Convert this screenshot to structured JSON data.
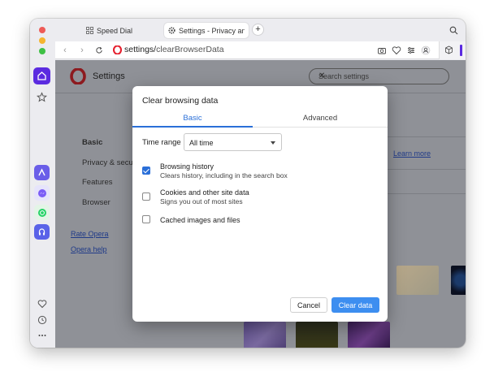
{
  "tabs": [
    {
      "label": "Speed Dial",
      "icon": "grid-icon"
    },
    {
      "label": "Settings - Privacy and se",
      "icon": "gear-icon"
    }
  ],
  "address_bar": {
    "url_prefix": "settings/",
    "url_path": "clearBrowserData"
  },
  "settings": {
    "title": "Settings",
    "search_placeholder": "Search settings",
    "menu": [
      "Basic",
      "Privacy & secu",
      "Features",
      "Browser"
    ],
    "links": [
      "Rate Opera",
      "Opera help"
    ],
    "learn_more": "Learn more"
  },
  "dialog": {
    "title": "Clear browsing data",
    "tabs": [
      "Basic",
      "Advanced"
    ],
    "active_tab": "Basic",
    "time_range_label": "Time range",
    "time_range_value": "All time",
    "options": [
      {
        "title": "Browsing history",
        "subtitle": "Clears history, including in the search box",
        "checked": true
      },
      {
        "title": "Cookies and other site data",
        "subtitle": "Signs you out of most sites",
        "checked": false
      },
      {
        "title": "Cached images and files",
        "subtitle": "",
        "checked": false
      }
    ],
    "cancel_label": "Cancel",
    "clear_label": "Clear data"
  },
  "colors": {
    "accent": "#2a6fd8",
    "sidebar_active": "#5b2be0",
    "clear_button": "#3d8ef0"
  }
}
